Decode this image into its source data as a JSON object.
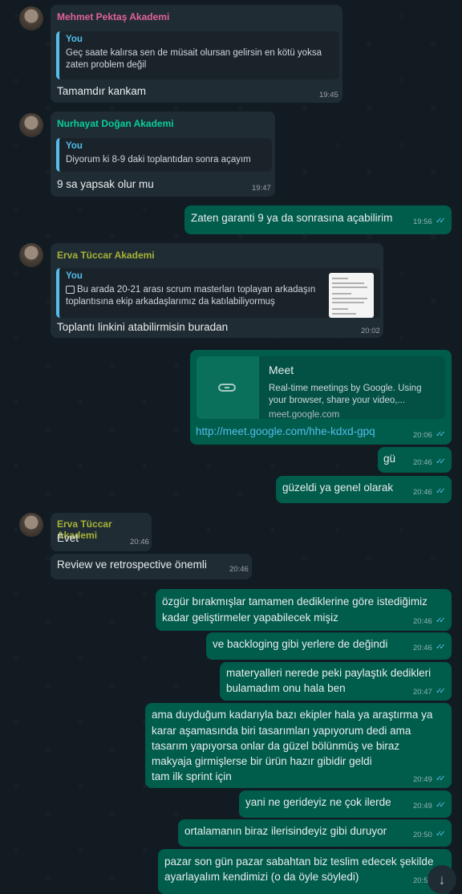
{
  "colors": {
    "chat_bg": "#111b21",
    "incoming_bubble": "#202c33",
    "outgoing_bubble": "#005c4b",
    "read_ticks": "#53bdeb"
  },
  "messages": [
    {
      "sender": "Mehmet Pektaş Akademi",
      "sender_color": "#e0629a",
      "quote_name": "You",
      "quote_line1": "Geç saate kalırsa sen de müsait olursan gelirsin en kötü yoksa",
      "quote_line2": "zaten problem değil",
      "text": "Tamamdır kankam",
      "time": "19:45"
    },
    {
      "sender": "Nurhayat Doğan Akademi",
      "sender_color": "#06cf9c",
      "quote_name": "You",
      "quote_line1": "Diyorum ki 8-9 daki toplantıdan sonra açayım",
      "text": "9 sa yapsak olur mu",
      "time": "19:47"
    },
    {
      "text": "Zaten garanti 9 ya da sonrasına açabilirim",
      "time": "19:56"
    },
    {
      "sender": "Erva Tüccar Akademi",
      "sender_color": "#a5b337",
      "quote_name": "You",
      "quote_line1": "Bu arada 20-21 arası scrum masterları toplayan arkadaşın",
      "quote_line2": "toplantısına ekip arkadaşlarımız da katılabiliyormuş",
      "quote_icon": "photo-icon",
      "text": "Toplantı linkini atabilirmisin buradan",
      "time": "20:02"
    },
    {
      "preview_title": "Meet",
      "preview_desc1": "Real-time meetings by Google. Using",
      "preview_desc2": "your browser, share your video,...",
      "preview_domain": "meet.google.com",
      "link": "http://meet.google.com/hhe-kdxd-gpq",
      "time": "20:06"
    },
    {
      "text": "gü",
      "time": "20:46"
    },
    {
      "text": "güzeldi ya genel olarak",
      "time": "20:46"
    },
    {
      "sender": "Erva Tüccar Akademi",
      "sender_color": "#a5b337",
      "text": "Evet",
      "time": "20:46"
    },
    {
      "text": "Review ve retrospective önemli",
      "time": "20:46"
    },
    {
      "line1": "özgür bırakmışlar tamamen dediklerine göre istediğimiz",
      "line2": "kadar geliştirmeler yapabilecek mişiz",
      "time": "20:46"
    },
    {
      "text": "ve backloging gibi yerlere de değindi",
      "time": "20:46"
    },
    {
      "line1": "materyalleri nerede peki paylaştık dedikleri",
      "line2": "bulamadım onu hala ben",
      "time": "20:47"
    },
    {
      "line1": "ama duyduğum kadarıyla bazı ekipler hala ya araştırma ya",
      "line2": "karar aşamasında biri tasarımları yapıyorum dedi ama",
      "line3": "tasarım yapıyorsa onlar da güzel bölünmüş ve biraz",
      "line4": "makyaja girmişlerse bir ürün hazır gibidir geldi",
      "line5": "tam ilk sprint için",
      "time": "20:49"
    },
    {
      "text": "yani ne gerideyiz ne çok ilerde",
      "time": "20:49"
    },
    {
      "text": "ortalamanın biraz ilerisindeyiz gibi duruyor",
      "time": "20:50"
    },
    {
      "line1": "pazar son gün pazar sabahtan biz teslim edecek şekilde",
      "line2": "ayarlayalım kendimizi (o da öyle söyledi)",
      "time": "20:5"
    }
  ],
  "icons": {
    "read": "double-check-icon",
    "scroll": "arrow-down-icon"
  }
}
